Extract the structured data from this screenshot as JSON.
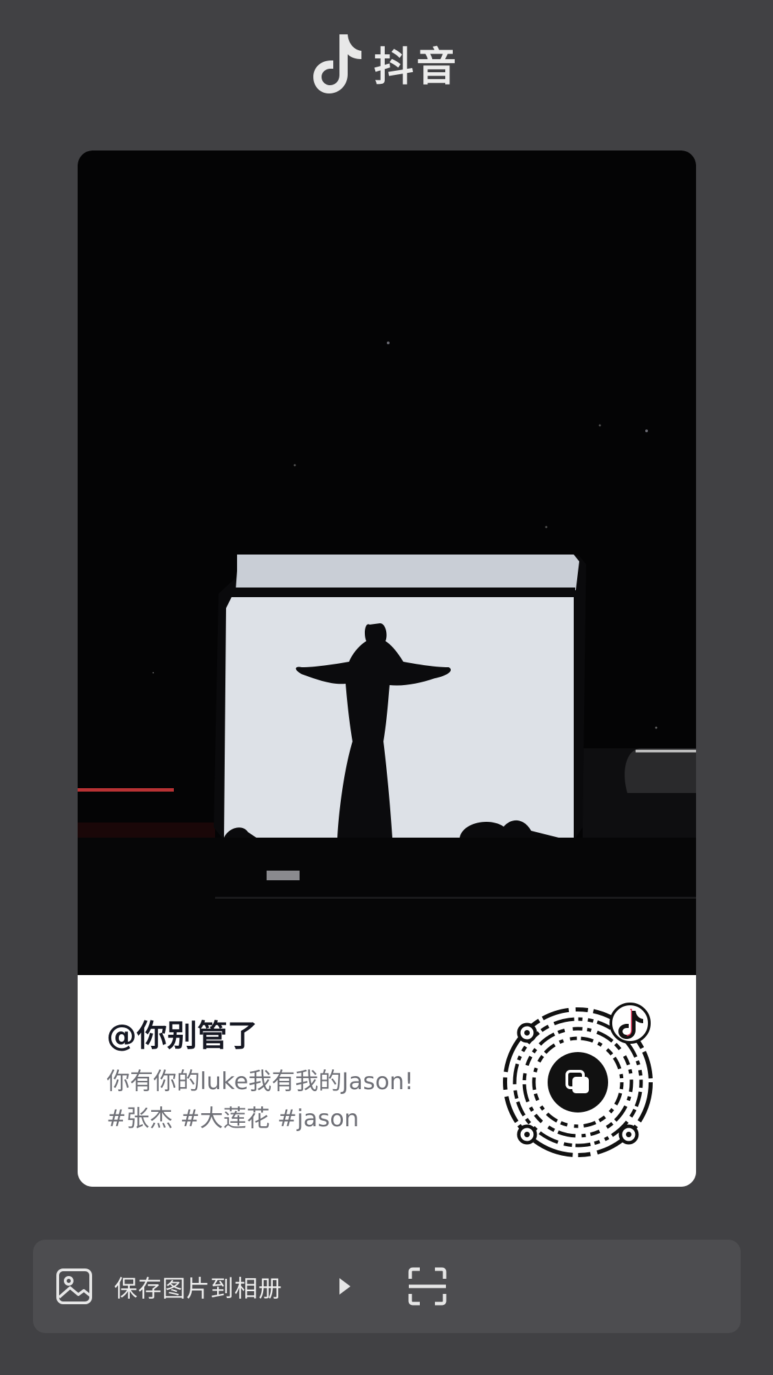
{
  "app": {
    "logo_text": "抖音",
    "logo_icon": "tiktok-note-icon"
  },
  "post": {
    "author": "@你别管了",
    "caption_line1": "你有你的luke我有我的Jason!",
    "caption_line2": "#张杰 #大莲花 #jason",
    "image": "silhouette-of-performer-with-outstretched-arms-on-stage-screen",
    "qr_badge_icon": "tiktok-note-icon"
  },
  "actions": {
    "save_label": "保存图片到相册",
    "save_icon": "image-icon",
    "play_icon": "play-triangle-icon",
    "scan_icon": "scan-icon"
  },
  "colors": {
    "page_bg": "#414144",
    "bar_bg": "#4d4d50",
    "card_bg": "#ffffff",
    "handle_text": "#161823",
    "caption_text": "#6f7077"
  }
}
